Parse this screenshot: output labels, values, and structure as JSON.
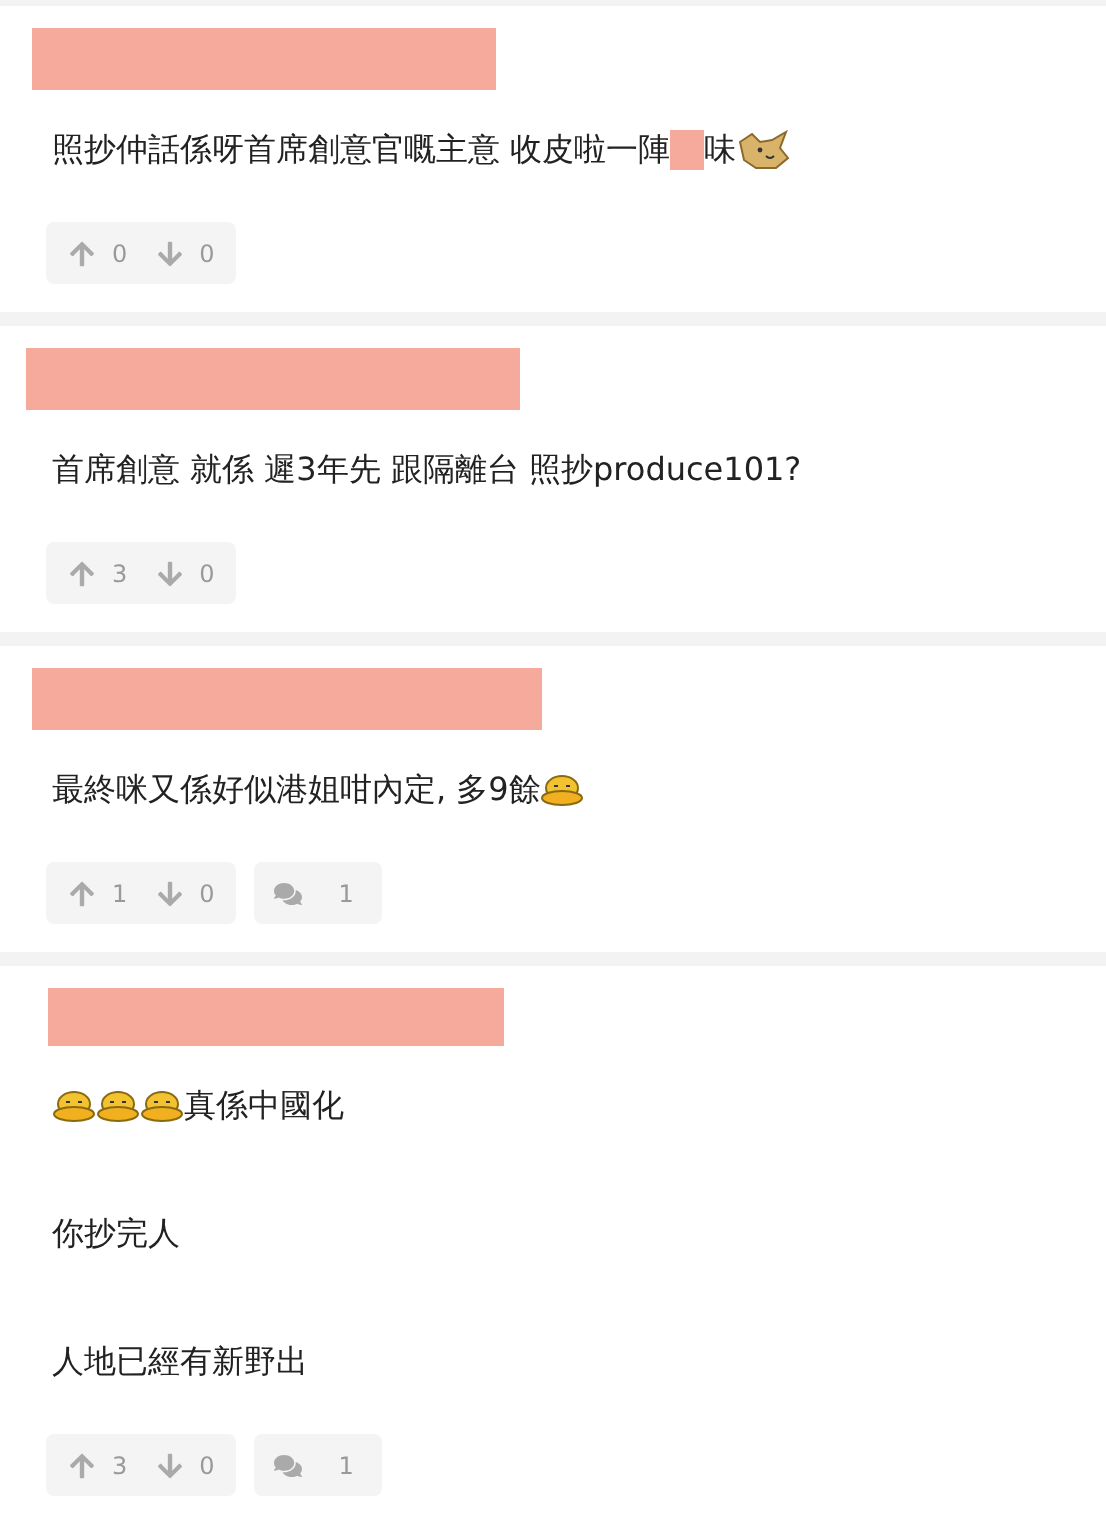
{
  "comments": [
    {
      "author_redacted": true,
      "lines": [
        [
          {
            "kind": "text",
            "text": "照抄仲話係呀首席創意官嘅主意 收皮啦一陣"
          },
          {
            "kind": "redaction"
          },
          {
            "kind": "text",
            "text": "味"
          },
          {
            "kind": "dog_emoji"
          }
        ]
      ],
      "upvotes": "0",
      "downvotes": "0"
    },
    {
      "author_redacted": true,
      "lines": [
        [
          {
            "kind": "text",
            "text": "首席創意 就係 遲3年先 跟隔離台 照抄produce101?"
          }
        ]
      ],
      "upvotes": "3",
      "downvotes": "0"
    },
    {
      "author_redacted": true,
      "lines": [
        [
          {
            "kind": "text",
            "text": "最終咪又係好似港姐咁內定, 多9餘"
          },
          {
            "kind": "duck_emoji"
          }
        ]
      ],
      "upvotes": "1",
      "downvotes": "0",
      "replies": "1"
    },
    {
      "author_redacted": true,
      "lines": [
        [
          {
            "kind": "duck_emoji"
          },
          {
            "kind": "duck_emoji"
          },
          {
            "kind": "duck_emoji"
          },
          {
            "kind": "text",
            "text": "真係中國化"
          }
        ],
        [
          {
            "kind": "text",
            "text": "你抄完人"
          }
        ],
        [
          {
            "kind": "text",
            "text": "人地已經有新野出"
          }
        ]
      ],
      "upvotes": "3",
      "downvotes": "0",
      "replies": "1"
    }
  ]
}
